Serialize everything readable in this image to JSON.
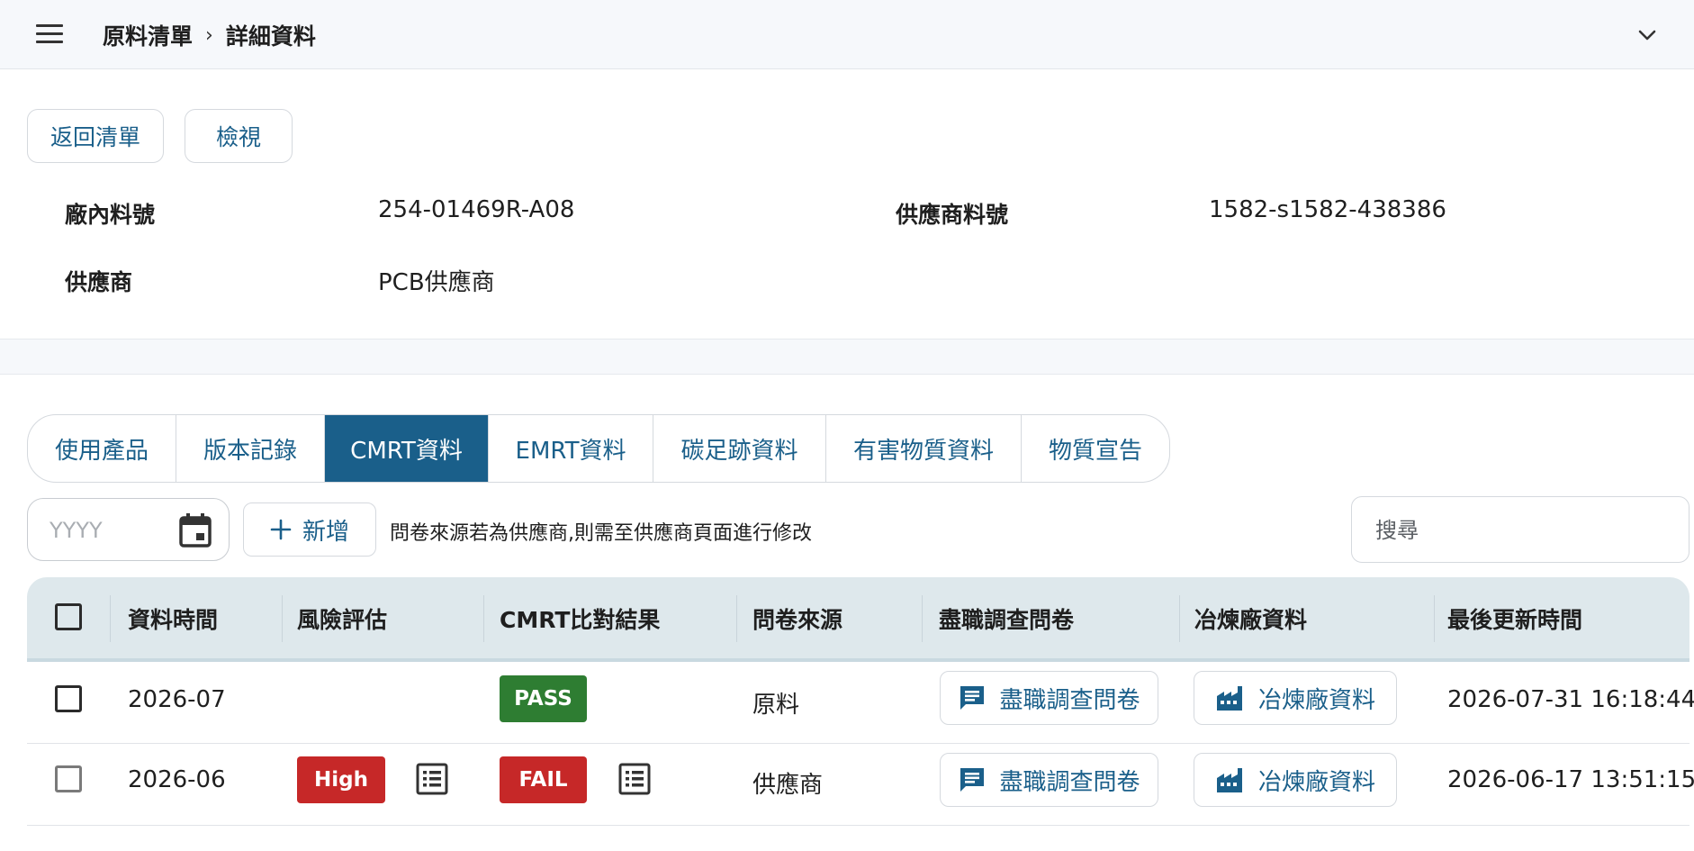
{
  "breadcrumb": {
    "parent": "原料清單",
    "separator": "›",
    "current": "詳細資料"
  },
  "icons": {
    "menu": "hamburger-menu-icon",
    "collapse": "chevron-down-icon",
    "calendar": "calendar-icon",
    "add": "plus-icon",
    "list": "list-document-icon",
    "chat": "chat-bubble-icon",
    "factory": "factory-icon"
  },
  "colors": {
    "accent": "#1a5f8a",
    "pass": "#2e7d32",
    "fail": "#c62828",
    "header_bg": "#dee8ec"
  },
  "actions": {
    "back": "返回清單",
    "view": "檢視"
  },
  "fields": {
    "internal_part_no": {
      "label": "廠內料號",
      "value": "254-01469R-A08"
    },
    "supplier_part_no": {
      "label": "供應商料號",
      "value": "1582-s1582-438386"
    },
    "supplier": {
      "label": "供應商",
      "value": "PCB供應商"
    }
  },
  "tabs": [
    "使用產品",
    "版本記錄",
    "CMRT資料",
    "EMRT資料",
    "碳足跡資料",
    "有害物質資料",
    "物質宣告"
  ],
  "active_tab": "CMRT資料",
  "toolbar": {
    "date_placeholder": "YYYY",
    "add_label": "新增",
    "hint": "問卷來源若為供應商,則需至供應商頁面進行修改",
    "search_placeholder": "搜尋"
  },
  "table": {
    "columns": [
      "資料時間",
      "風險評估",
      "CMRT比對結果",
      "問卷來源",
      "盡職調查問卷",
      "冶煉廠資料",
      "最後更新時間"
    ],
    "rows": [
      {
        "date": "2026-07",
        "risk": "",
        "result": "PASS",
        "source": "原料",
        "dd_label": "盡職調查問卷",
        "smelter_label": "冶煉廠資料",
        "updated": "2026-07-31 16:18:44"
      },
      {
        "date": "2026-06",
        "risk": "High",
        "result": "FAIL",
        "source": "供應商",
        "dd_label": "盡職調查問卷",
        "smelter_label": "冶煉廠資料",
        "updated": "2026-06-17 13:51:15"
      }
    ]
  }
}
